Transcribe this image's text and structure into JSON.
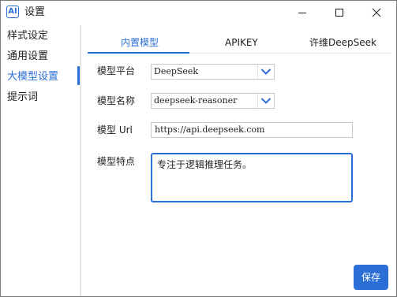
{
  "window": {
    "icon_text": "AI",
    "title": "设置",
    "controls": [
      "minimize",
      "maximize",
      "close"
    ]
  },
  "sidebar": {
    "items": [
      {
        "label": "样式设定"
      },
      {
        "label": "通用设置"
      },
      {
        "label": "大模型设置",
        "active": true
      },
      {
        "label": "提示词"
      }
    ]
  },
  "tabs": [
    {
      "label": "内置模型",
      "active": true
    },
    {
      "label": "APIKEY"
    },
    {
      "label": "许维DeepSeek"
    }
  ],
  "form": {
    "platform": {
      "label": "模型平台",
      "value": "DeepSeek"
    },
    "model_name": {
      "label": "模型名称",
      "value": "deepseek-reasoner"
    },
    "model_url": {
      "label": "模型 Url",
      "value": "https://api.deepseek.com"
    },
    "model_feature": {
      "label": "模型特点",
      "value": "专注于逻辑推理任务。"
    }
  },
  "actions": {
    "save_label": "保存"
  },
  "icons": {
    "app": "ai-logo-icon",
    "minimize": "minimize-icon",
    "maximize": "maximize-icon",
    "close": "close-icon",
    "dropdown": "chevron-down-icon"
  },
  "colors": {
    "accent": "#2b6ed6",
    "text": "#1f1f1f",
    "border": "#c8c8c8",
    "divider": "#e6e6e6"
  }
}
